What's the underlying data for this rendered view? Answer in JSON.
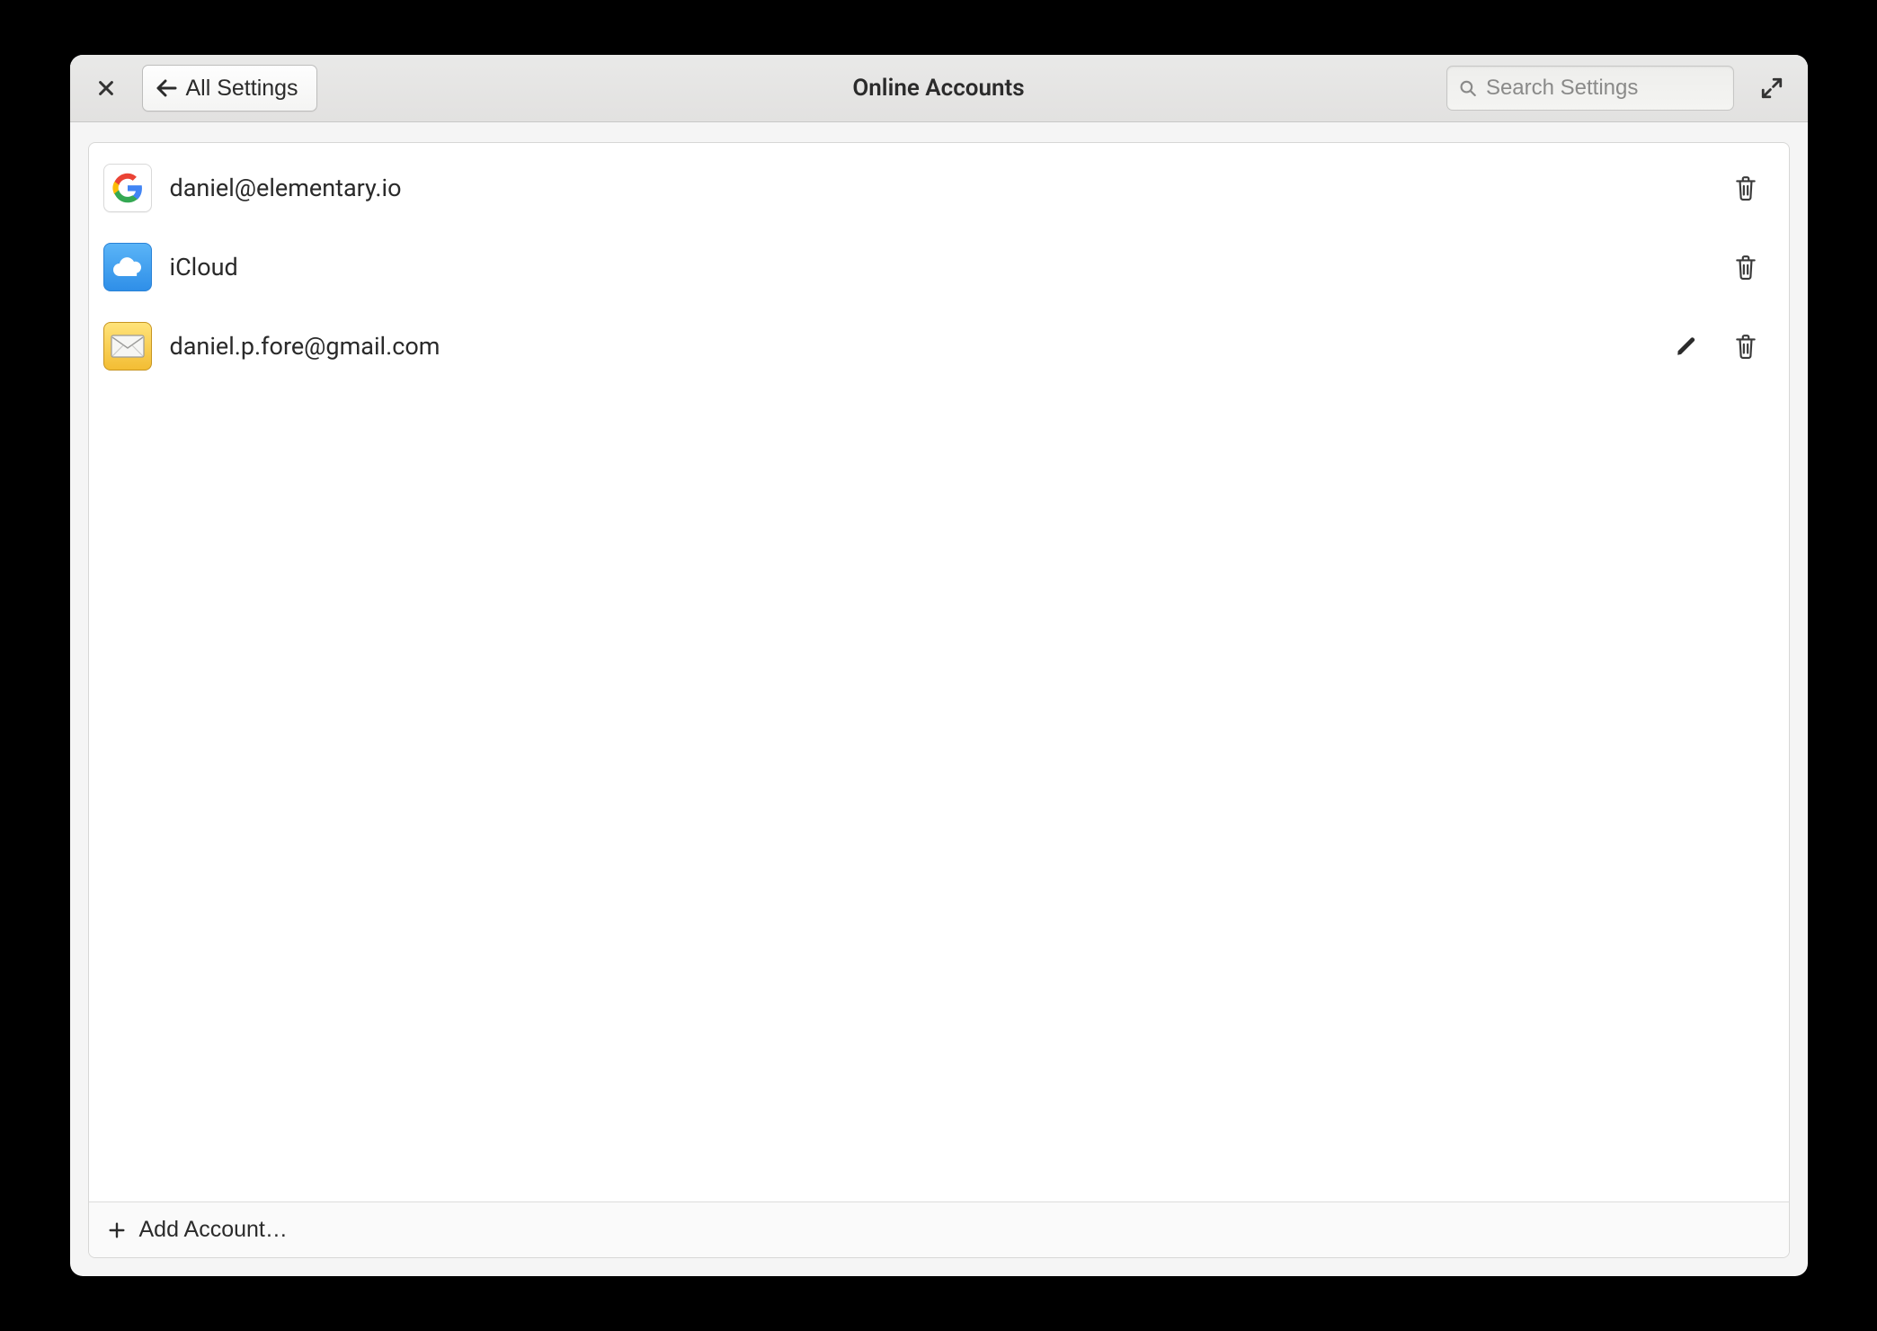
{
  "header": {
    "title": "Online Accounts",
    "back_label": "All Settings",
    "search_placeholder": "Search Settings"
  },
  "accounts": [
    {
      "provider": "google",
      "label": "daniel@elementary.io",
      "editable": false
    },
    {
      "provider": "icloud",
      "label": "iCloud",
      "editable": false
    },
    {
      "provider": "mail",
      "label": "daniel.p.fore@gmail.com",
      "editable": true
    }
  ],
  "footer": {
    "add_label": "Add Account…"
  }
}
